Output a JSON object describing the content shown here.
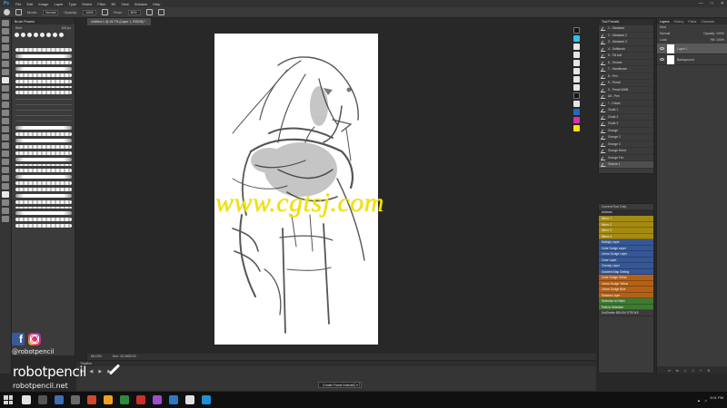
{
  "menubar": {
    "logo": "Ps",
    "items": [
      "File",
      "Edit",
      "Image",
      "Layer",
      "Type",
      "Select",
      "Filter",
      "3D",
      "View",
      "Window",
      "Help"
    ]
  },
  "options": {
    "mode_label": "Mode:",
    "mode_value": "Normal",
    "opacity_label": "Opacity:",
    "opacity_value": "100%",
    "flow_label": "Flow:",
    "flow_value": "80%",
    "icons": [
      "brush-icon",
      "brush-panel-icon",
      "pressure-opacity-icon",
      "airbrush-icon",
      "pressure-size-icon"
    ]
  },
  "brush_panel": {
    "tab_label": "Brush Presets",
    "size_label": "Size:",
    "size_value": "100 px"
  },
  "document": {
    "tab_title": "Untitled-1 @ 15.7% (Layer 1, RGB/8) *",
    "zoom_value": "66.13%",
    "doc_info": "Doc: 10.2M/0.00"
  },
  "timeline": {
    "header": "Timeline",
    "button_label": "Create Frame Animation"
  },
  "tool_presets": {
    "header": "Tool Presets",
    "items": [
      "1 - Standard",
      "2 - Standard 2",
      "3 - Standard 3",
      "4 - Softbrush",
      "5 - Tilt soft",
      "6 - Texture",
      "7 - Handbrush",
      "8 - Pen",
      "9 - Pencil",
      "0 - Pencil WHB",
      "Alt - Pen",
      "* - Chisel",
      "Chalk 1",
      "Chalk 2",
      "Chalk 3",
      "Grunge",
      "Grunge 2",
      "Grunge 3",
      "Grunge Dried",
      "Grunge Fat",
      "Texture 1"
    ]
  },
  "layers": {
    "tabs": [
      "Layers",
      "History",
      "Paths",
      "Channels"
    ],
    "kind_label": "Kind",
    "blend_mode": "Normal",
    "opacity_label": "Opacity:",
    "opacity_value": "100%",
    "lock_label": "Lock:",
    "fill_label": "Fill:",
    "fill_value": "100%",
    "items": [
      {
        "name": "Layer 1"
      },
      {
        "name": "Background"
      }
    ]
  },
  "actions": {
    "tool_title": "Current Tool Only",
    "header": "Actions",
    "items": [
      {
        "label": "Mirror 1",
        "color": "gold"
      },
      {
        "label": "Mirror 2",
        "color": "gold"
      },
      {
        "label": "Mirror 3",
        "color": "gold"
      },
      {
        "label": "Mirror 4",
        "color": "gold"
      },
      {
        "label": "Multiply Layer",
        "color": "blue"
      },
      {
        "label": "Color Dodge Layer",
        "color": "blue"
      },
      {
        "label": "Linear Dodge Layer",
        "color": "blue"
      },
      {
        "label": "Color Layer",
        "color": "blue"
      },
      {
        "label": "Overlay Layer",
        "color": "blue"
      },
      {
        "label": "Gradient Map Setting",
        "color": "blue"
      },
      {
        "label": "Color Dodge Yellow",
        "color": "orange"
      },
      {
        "label": "Linear Dodge Yellow",
        "color": "orange"
      },
      {
        "label": "Linear Dodge Blue",
        "color": "orange"
      },
      {
        "label": "Shadow Layer",
        "color": "orange"
      },
      {
        "label": "Selection to Paths",
        "color": "green"
      },
      {
        "label": "Path to Selection",
        "color": "green"
      },
      {
        "label": "Set/Delete BRUSH STROKE",
        "color": "plain"
      }
    ]
  },
  "watermark": "www.cgtsj.com",
  "branding": {
    "handle": "@robotpencil",
    "name": "robotpencil",
    "site": "robotpencil.net",
    "icons": [
      "facebook-icon",
      "instagram-icon"
    ]
  },
  "taskbar": {
    "time": "3:01 PM",
    "apps": [
      "#e2e2e2",
      "#555555",
      "#3c6fb4",
      "#6a6a6a",
      "#d04a2b",
      "#f0a020",
      "#2f8a3b",
      "#cf2d2d",
      "#9c4dcc",
      "#2d79c7",
      "#e0e0e0",
      "#1f8fd6"
    ]
  }
}
